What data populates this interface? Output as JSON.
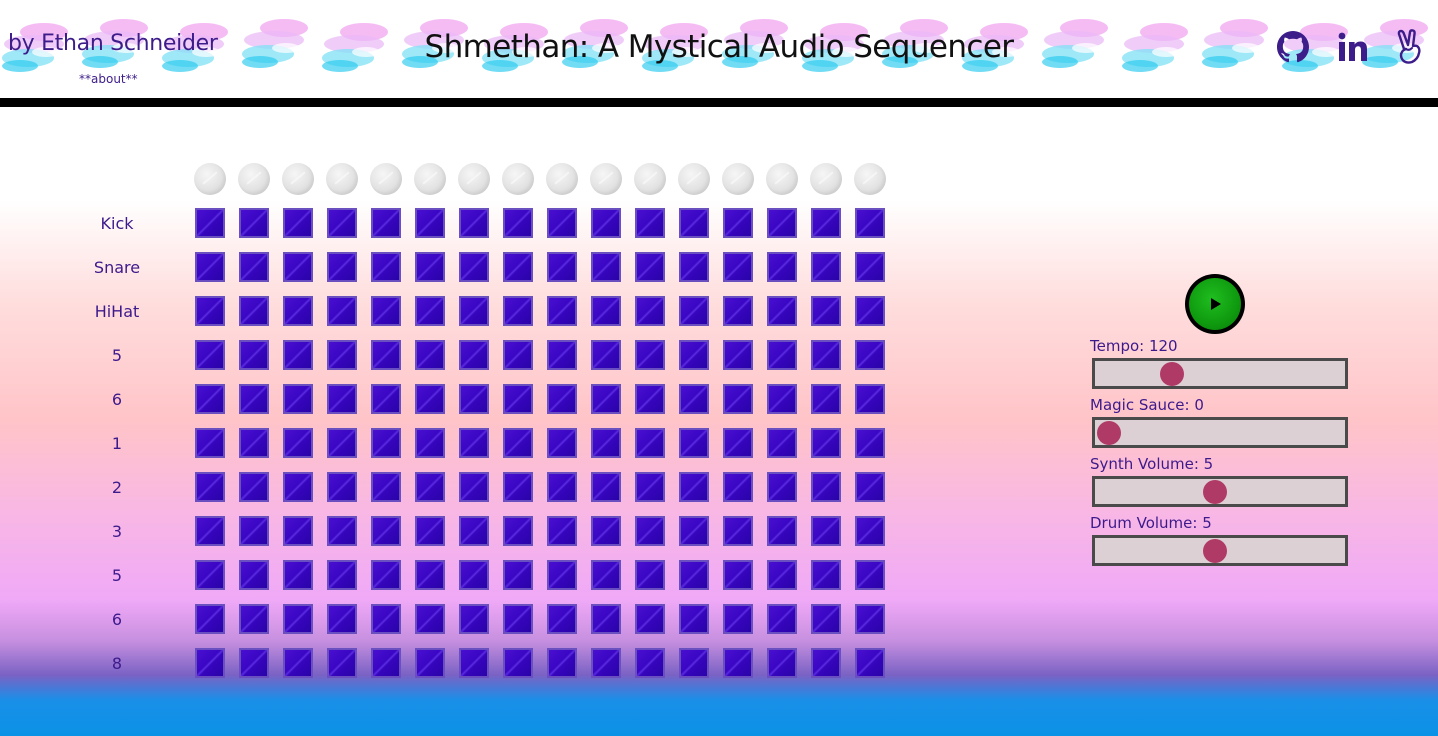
{
  "header": {
    "byline": "by Ethan Schneider",
    "about_link": "**about**",
    "title": "Shmethan: A Mystical Audio Sequencer",
    "social": [
      "github-icon",
      "linkedin-icon",
      "peace-hand-icon"
    ],
    "accent_color": "#3d1d8a"
  },
  "sequencer": {
    "steps": 16,
    "rows": [
      {
        "label": "Kick"
      },
      {
        "label": "Snare"
      },
      {
        "label": "HiHat"
      },
      {
        "label": "5"
      },
      {
        "label": "6"
      },
      {
        "label": "1"
      },
      {
        "label": "2"
      },
      {
        "label": "3"
      },
      {
        "label": "5"
      },
      {
        "label": "6"
      },
      {
        "label": "8"
      }
    ],
    "cell_color": "#3a06c4"
  },
  "controls": {
    "play_icon": "play-icon",
    "sliders": [
      {
        "name": "tempo",
        "label": "Tempo: 120",
        "value_fraction": 0.28
      },
      {
        "name": "magic-sauce",
        "label": "Magic Sauce: 0",
        "value_fraction": 0.0
      },
      {
        "name": "synth-volume",
        "label": "Synth Volume: 5",
        "value_fraction": 0.47
      },
      {
        "name": "drum-volume",
        "label": "Drum Volume: 5",
        "value_fraction": 0.47
      }
    ],
    "thumb_color": "#b03a66"
  }
}
